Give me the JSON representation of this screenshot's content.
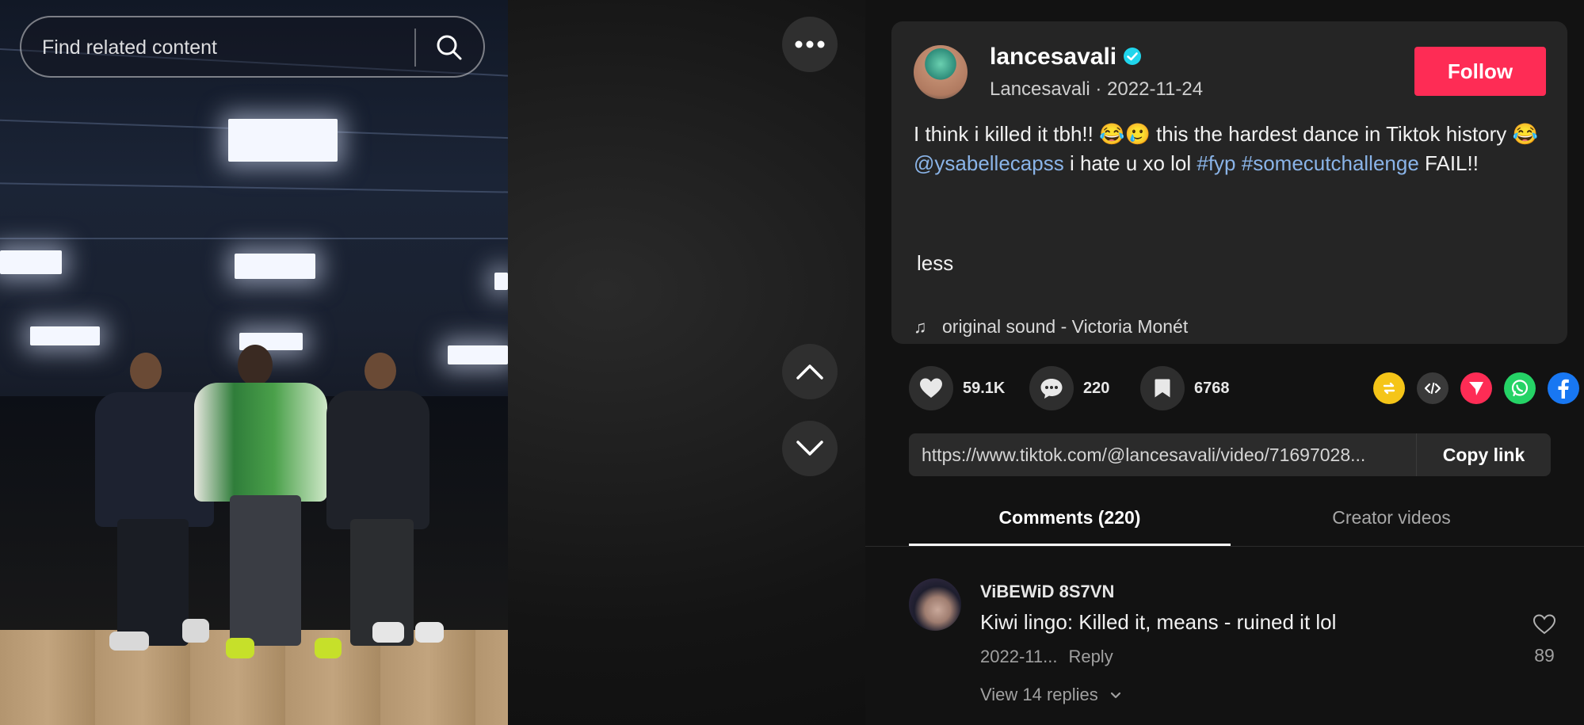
{
  "search": {
    "placeholder": "Find related content"
  },
  "post": {
    "username": "lancesavali",
    "nickname": "Lancesavali",
    "date": "2022-11-24",
    "follow_label": "Follow",
    "description_text_1": "I think i killed it tbh!! 😂🥲 this the hardest dance in Tiktok history 😂 ",
    "mention": "@ysabellecapss",
    "description_text_2": " i hate u xo lol ",
    "hashtag_1": "#fyp",
    "hashtag_2": "#somecutchallenge",
    "description_text_3": " FAIL!!",
    "less_label": "less",
    "music": "original sound - Victoria Monét"
  },
  "stats": {
    "likes": "59.1K",
    "comments": "220",
    "saves": "6768"
  },
  "share_icons": [
    "repost-icon",
    "embed-icon",
    "send-icon",
    "whatsapp-icon",
    "facebook-icon",
    "share-arrow-icon"
  ],
  "link": {
    "url": "https://www.tiktok.com/@lancesavali/video/71697028...",
    "copy_label": "Copy link"
  },
  "tabs": [
    {
      "label": "Comments (220)",
      "active": true
    },
    {
      "label": "Creator videos",
      "active": false
    }
  ],
  "comments": [
    {
      "user": "ViBEWiD 8S7VN",
      "text": "Kiwi lingo: Killed it, means - ruined it lol",
      "date": "2022-11...",
      "reply_label": "Reply",
      "view_replies": "View 14 replies",
      "likes": "89"
    }
  ],
  "colors": {
    "follow": "#fe2c55",
    "link_blue": "#8ab4e8",
    "repost": "#f5c518",
    "send": "#fe2c55",
    "whatsapp": "#25d366",
    "facebook": "#1877f2"
  }
}
